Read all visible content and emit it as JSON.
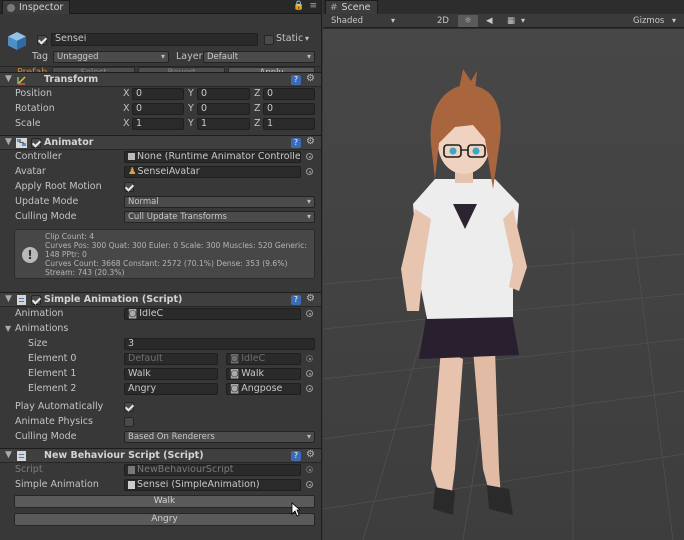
{
  "inspector": {
    "tab_label": "Inspector",
    "tab_icons": [
      "lock-icon",
      "menu-icon"
    ],
    "object": {
      "name": "Sensei",
      "static_label": "Static",
      "tag_label": "Tag",
      "tag_value": "Untagged",
      "layer_label": "Layer",
      "layer_value": "Default",
      "prefab_label": "Prefab",
      "select_label": "Select",
      "revert_label": "Revert",
      "apply_label": "Apply"
    },
    "transform": {
      "title": "Transform",
      "position_label": "Position",
      "rotation_label": "Rotation",
      "scale_label": "Scale",
      "axis_x": "X",
      "axis_y": "Y",
      "axis_z": "Z",
      "position": [
        "0",
        "0",
        "0"
      ],
      "rotation": [
        "0",
        "0",
        "0"
      ],
      "scale": [
        "1",
        "1",
        "1"
      ]
    },
    "animator": {
      "title": "Animator",
      "controller_label": "Controller",
      "controller_value": "None (Runtime Animator Controller)",
      "avatar_label": "Avatar",
      "avatar_value": "SenseiAvatar",
      "apply_root_motion_label": "Apply Root Motion",
      "update_mode_label": "Update Mode",
      "update_mode_value": "Normal",
      "culling_mode_label": "Culling Mode",
      "culling_mode_value": "Cull Update Transforms",
      "info_lines": [
        "Clip Count: 4",
        "Curves Pos: 300 Quat: 300 Euler: 0 Scale: 300 Muscles: 520 Generic: 148 PPtr: 0",
        "Curves Count: 3668 Constant: 2572 (70.1%) Dense: 353 (9.6%)",
        "Stream: 743 (20.3%)"
      ]
    },
    "simple_animation": {
      "title": "Simple Animation (Script)",
      "animation_label": "Animation",
      "animation_value": "IdleC",
      "animations_label": "Animations",
      "size_label": "Size",
      "size_value": "3",
      "elements": [
        {
          "label": "Element 0",
          "name": "Default",
          "clip": "IdleC",
          "dimmed": true
        },
        {
          "label": "Element 1",
          "name": "Walk",
          "clip": "Walk",
          "dimmed": false
        },
        {
          "label": "Element 2",
          "name": "Angry",
          "clip": "Angpose",
          "dimmed": false
        }
      ],
      "play_automatically_label": "Play Automatically",
      "animate_physics_label": "Animate Physics",
      "culling_mode_label": "Culling Mode",
      "culling_mode_value": "Based On Renderers"
    },
    "new_behaviour": {
      "title": "New Behaviour Script (Script)",
      "script_label": "Script",
      "script_value": "NewBehaviourScript",
      "simple_animation_label": "Simple Animation",
      "simple_animation_value": "Sensei (SimpleAnimation)",
      "walk_button": "Walk",
      "angry_button": "Angry"
    }
  },
  "scene": {
    "tab_label": "Scene",
    "shading_mode": "Shaded",
    "mode_2d": "2D",
    "gizmos_label": "Gizmos",
    "toolbar_icons": [
      "light-icon",
      "audio-icon",
      "image-effects-icon"
    ]
  },
  "colors": {
    "panel_bg": "#383838",
    "header_bg": "#3f3f3f",
    "field_bg": "#2a2a2a",
    "prefab_orange": "#d0852f",
    "help_blue": "#3c6bb5",
    "scene_bg": "#444444"
  }
}
